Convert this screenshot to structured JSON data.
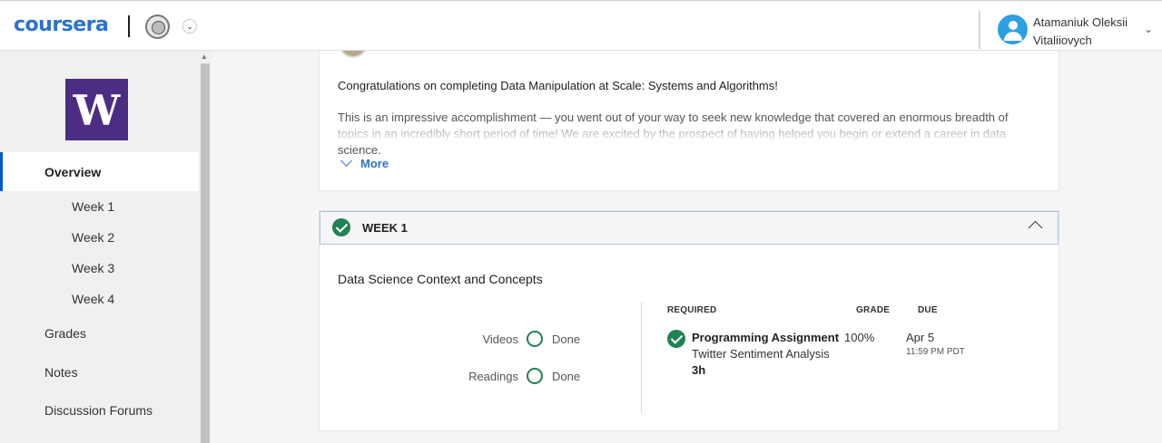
{
  "header": {
    "logo": "coursera",
    "user_name": "Atamaniuk Oleksii Vitaliiovych"
  },
  "sidebar": {
    "partner_logo_letter": "W",
    "overview": "Overview",
    "weeks": [
      "Week 1",
      "Week 2",
      "Week 3",
      "Week 4"
    ],
    "items": [
      "Grades",
      "Notes",
      "Discussion Forums"
    ]
  },
  "intro": {
    "congrats": "Congratulations on completing Data Manipulation at Scale: Systems and Algorithms!",
    "body": "This is an impressive accomplishment — you went out of your way to seek new knowledge that covered an enormous breadth of topics in an incredibly short period of time! We are excited by the prospect of having helped you begin or extend a career in data science.",
    "more_label": "More"
  },
  "week": {
    "title": "WEEK 1",
    "topic": "Data Science Context and Concepts",
    "progress": [
      {
        "label": "Videos",
        "status": "Done"
      },
      {
        "label": "Readings",
        "status": "Done"
      }
    ],
    "columns": {
      "required": "REQUIRED",
      "grade": "GRADE",
      "due": "DUE"
    },
    "item": {
      "title": "Programming Assignment",
      "subtitle": "Twitter Sentiment Analysis",
      "duration": "3h",
      "grade": "100%",
      "due_date": "Apr 5",
      "due_time": "11:59 PM PDT"
    }
  },
  "colors": {
    "brand_blue": "#2a73cc",
    "uw_purple": "#4b2e83",
    "success_green": "#1f8354",
    "avatar_blue": "#2d9fe2"
  }
}
